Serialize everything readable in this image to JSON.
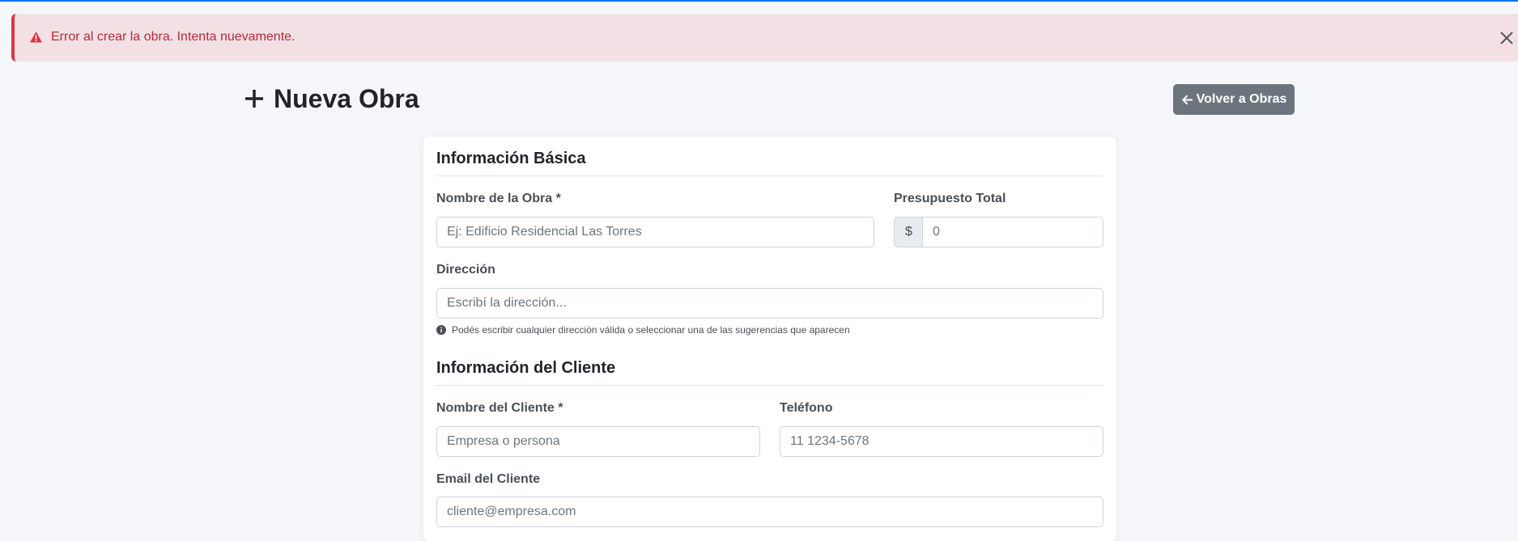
{
  "alert": {
    "message": "Error al crear la obra. Intenta nuevamente.",
    "icon": "warning-triangle-icon",
    "close_icon": "close-icon",
    "color": "#dc3545"
  },
  "header": {
    "title": "Nueva Obra",
    "title_icon": "plus-icon",
    "back_button": "Volver a Obras",
    "back_icon": "arrow-left-icon"
  },
  "form": {
    "basic_section": "Información Básica",
    "obra_name": {
      "label": "Nombre de la Obra *",
      "placeholder": "Ej: Edificio Residencial Las Torres"
    },
    "budget": {
      "label": "Presupuesto Total",
      "prefix": "$",
      "placeholder": "0"
    },
    "address": {
      "label": "Dirección",
      "placeholder": "Escribí la dirección...",
      "help": "Podés escribir cualquier dirección válida o seleccionar una de las sugerencias que aparecen",
      "help_icon": "info-circle-icon"
    },
    "client_section": "Información del Cliente",
    "client_name": {
      "label": "Nombre del Cliente *",
      "placeholder": "Empresa o persona"
    },
    "phone": {
      "label": "Teléfono",
      "placeholder": "11 1234-5678"
    },
    "email": {
      "label": "Email del Cliente",
      "placeholder": "cliente@empresa.com"
    }
  },
  "colors": {
    "accent_line": "#0d6efd",
    "alert_bg": "#f2e0e4",
    "button_secondary": "#6c757d",
    "page_bg": "#f4f6f9"
  }
}
